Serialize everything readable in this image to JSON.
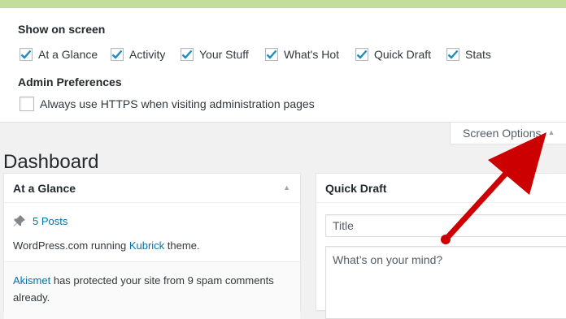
{
  "screen_options": {
    "heading": "Show on screen",
    "checkboxes": [
      {
        "label": "At a Glance",
        "checked": true
      },
      {
        "label": "Activity",
        "checked": true
      },
      {
        "label": "Your Stuff",
        "checked": true
      },
      {
        "label": "What's Hot",
        "checked": true
      },
      {
        "label": "Quick Draft",
        "checked": true
      },
      {
        "label": "Stats",
        "checked": true
      }
    ],
    "admin_heading": "Admin Preferences",
    "https_label": "Always use HTTPS when visiting administration pages",
    "https_checked": false,
    "tab_label": "Screen Options"
  },
  "dashboard": {
    "title": "Dashboard"
  },
  "at_a_glance": {
    "title": "At a Glance",
    "posts_link": "5 Posts",
    "running_prefix": "WordPress.com running ",
    "theme_link": "Kubrick",
    "running_suffix": " theme.",
    "akismet_link": "Akismet",
    "akismet_text": " has protected your site from 9 spam comments already."
  },
  "quick_draft": {
    "title": "Quick Draft",
    "title_placeholder": "Title",
    "content_placeholder": "What’s on your mind?"
  },
  "colors": {
    "accent": "#c5dd9b",
    "link": "#0073aa",
    "checkmark": "#1e8cbe",
    "arrow": "#cc0000"
  }
}
